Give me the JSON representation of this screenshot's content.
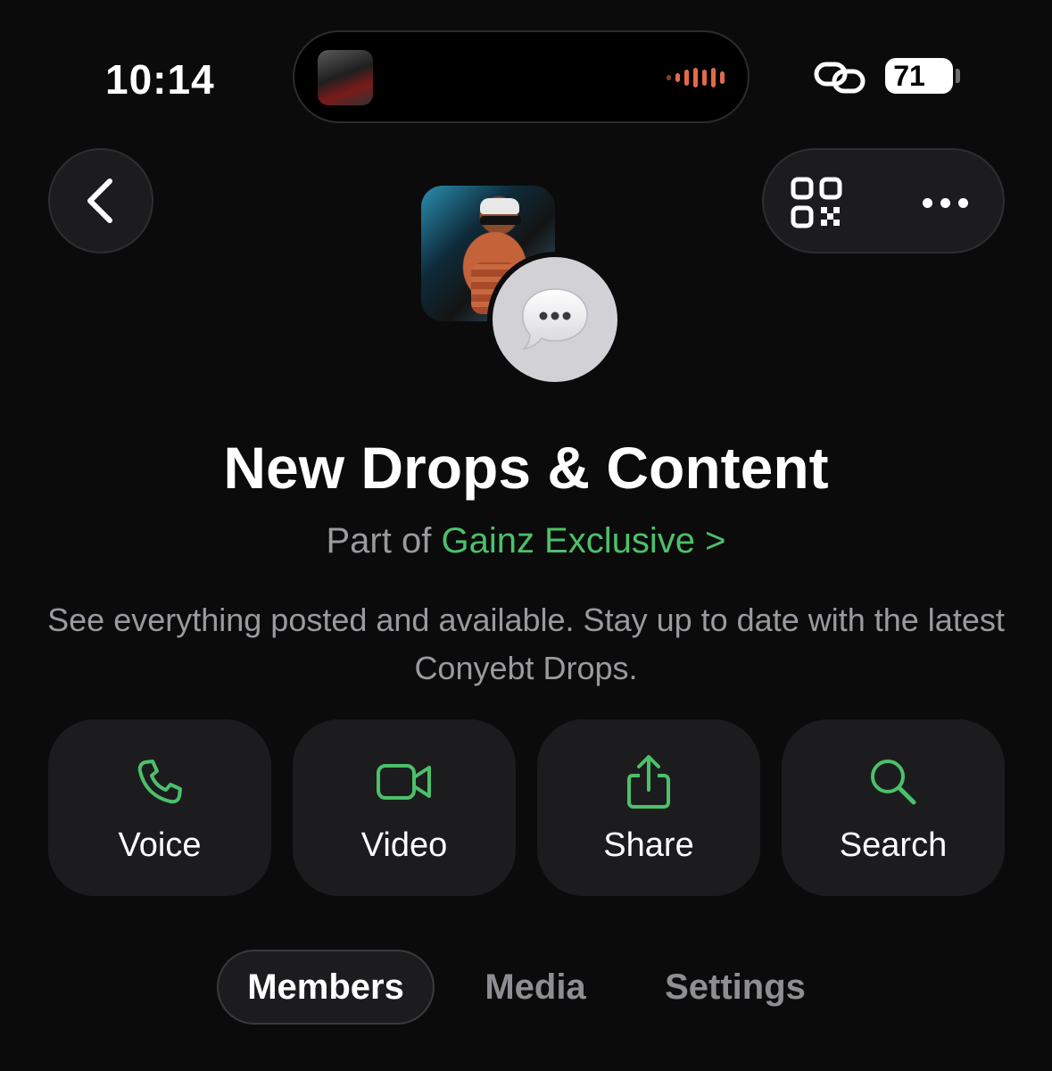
{
  "status_bar": {
    "time": "10:14",
    "battery_level": "71"
  },
  "group": {
    "name": "New Drops & Content",
    "part_of_prefix": "Part of",
    "community_name": "Gainz Exclusive",
    "chevron": ">",
    "description": "See everything posted and available. Stay up to date with the latest Conyebt Drops."
  },
  "actions": [
    {
      "label": "Voice",
      "icon": "phone-icon"
    },
    {
      "label": "Video",
      "icon": "video-camera-icon"
    },
    {
      "label": "Share",
      "icon": "share-icon"
    },
    {
      "label": "Search",
      "icon": "search-icon"
    }
  ],
  "tabs": [
    {
      "label": "Members",
      "active": true
    },
    {
      "label": "Media",
      "active": false
    },
    {
      "label": "Settings",
      "active": false
    }
  ],
  "colors": {
    "accent_green": "#4cc06a",
    "background": "#0b0b0b",
    "button_surface": "#1c1c1e",
    "secondary_text": "#9a9a9f"
  }
}
